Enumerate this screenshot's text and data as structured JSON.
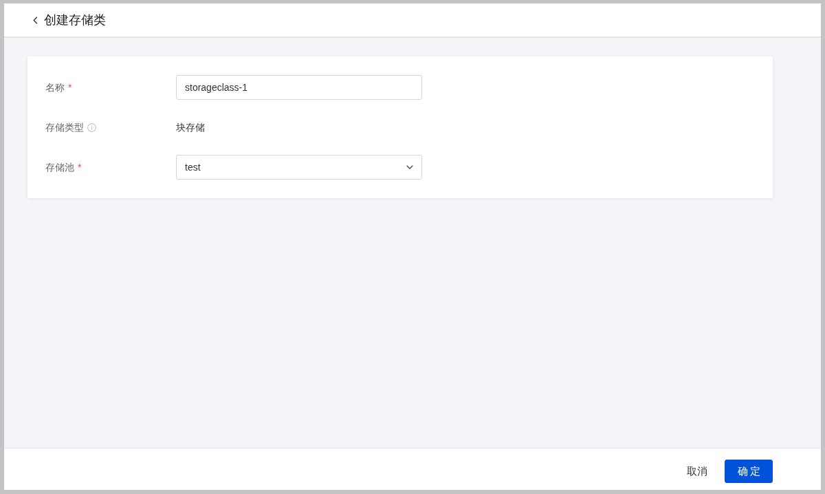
{
  "header": {
    "title": "创建存储类"
  },
  "form": {
    "fields": [
      {
        "kind": "input",
        "label": "名称",
        "required_mark": "*",
        "has_info": false,
        "value": "storageclass-1"
      },
      {
        "kind": "text",
        "label": "存储类型",
        "has_info": true,
        "value": "块存储"
      },
      {
        "kind": "select",
        "label": "存储池",
        "required_mark": "*",
        "has_info": false,
        "value": "test"
      }
    ]
  },
  "footer": {
    "buttons": [
      {
        "kind": "secondary",
        "label": "取消"
      },
      {
        "kind": "primary",
        "label": "确定"
      }
    ]
  }
}
